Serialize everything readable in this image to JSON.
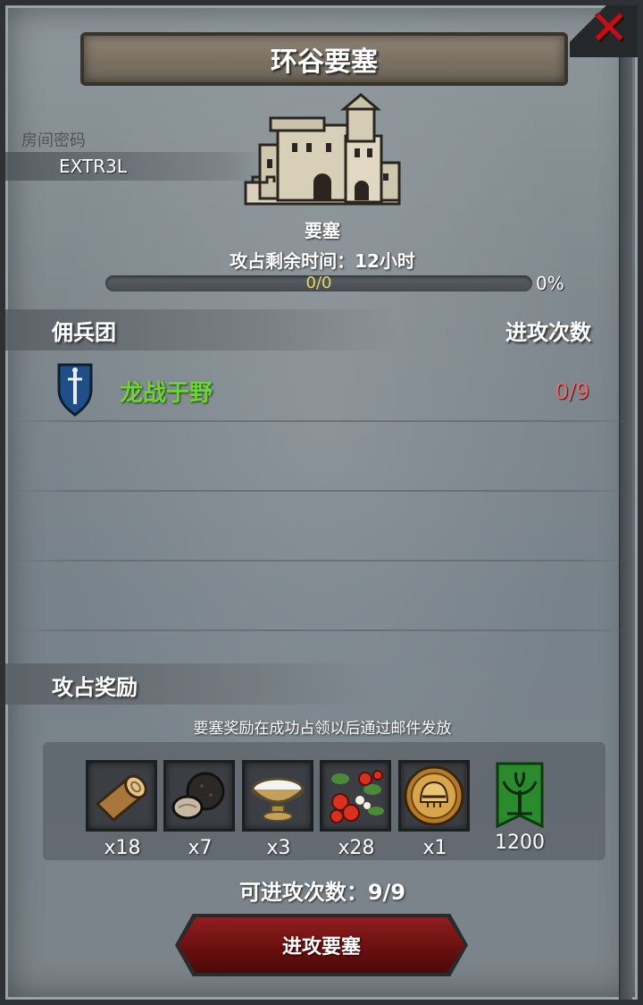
{
  "dialog": {
    "title": "环谷要塞",
    "close_icon": "close-icon"
  },
  "room": {
    "label": "房间密码",
    "code": "EXTR3L"
  },
  "fortress": {
    "type": "要塞",
    "time_left_text": "攻占剩余时间：12小时",
    "progress_text": "0/0",
    "progress_percent_text": "0%",
    "progress_fraction": 0
  },
  "mercenary_section": {
    "title": "佣兵团",
    "attacks_header": "进攻次数",
    "rows": [
      {
        "icon": "shield-sword-icon",
        "name": "龙战于野",
        "attacks": "0/9"
      }
    ]
  },
  "rewards_section": {
    "title": "攻占奖励",
    "note": "要塞奖励在成功占领以后通过邮件发放",
    "items": [
      {
        "icon": "wood-log-icon",
        "quantity": "x18"
      },
      {
        "icon": "truffle-icon",
        "quantity": "x7"
      },
      {
        "icon": "milk-bowl-icon",
        "quantity": "x3"
      },
      {
        "icon": "berries-icon",
        "quantity": "x28"
      },
      {
        "icon": "knight-helmet-coin-icon",
        "quantity": "x1"
      }
    ],
    "banner": {
      "icon": "tree-banner-icon",
      "amount": "1200"
    }
  },
  "attacks_remaining": "可进攻次数：9/9",
  "attack_button": "进攻要塞",
  "colors": {
    "mercenary_name": "#6fd23b",
    "attack_count": "#e56a6a",
    "close_x": "#c0101a",
    "button_red": "#6a1010"
  }
}
